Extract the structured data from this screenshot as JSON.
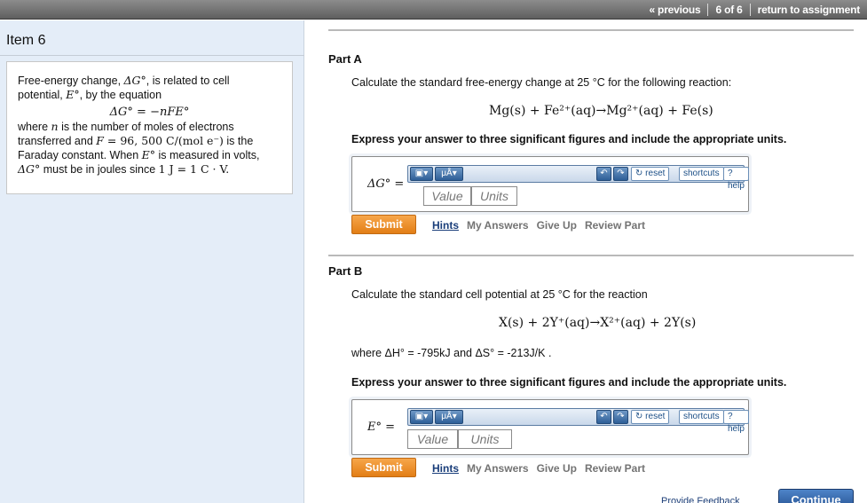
{
  "nav": {
    "previous": "« previous",
    "position": "6 of 6",
    "return": "return to assignment"
  },
  "sidebar": {
    "item_title": "Item 6",
    "info": {
      "l1a": "Free-energy change, ",
      "l1b": "ΔG°",
      "l1c": ", is related to cell",
      "l2a": "potential, ",
      "l2b": "E°",
      "l2c": ", by the equation",
      "equation": "ΔG° = −nFE°",
      "l4a": "where ",
      "l4b": "n",
      "l4c": " is the number of moles of electrons",
      "l5a": "transferred and ",
      "l5b": "F",
      "l5c": " = 96, 500 C/(mol e⁻)",
      "l5d": " is the",
      "l6": "Faraday constant. When ",
      "l6b": "E°",
      "l6c": " is measured in volts,",
      "l7a": "ΔG°",
      "l7b": " must be in joules since ",
      "l7c": "1 J = 1 C · V."
    }
  },
  "partA": {
    "title": "Part A",
    "question": "Calculate the standard free-energy change at 25 °C for the following reaction:",
    "reaction": "Mg(s) + Fe²⁺(aq)→Mg²⁺(aq) + Fe(s)",
    "instruction": "Express your answer to three significant figures and include the appropriate units.",
    "answer_label": "ΔG° =",
    "value_placeholder": "Value",
    "units_placeholder": "Units",
    "submit": "Submit"
  },
  "partB": {
    "title": "Part B",
    "question": "Calculate the standard cell potential at 25 °C for the reaction",
    "reaction": "X(s) + 2Y⁺(aq)→X²⁺(aq) + 2Y(s)",
    "where": "where ΔH° = -795kJ and ΔS° = -213J/K .",
    "instruction": "Express your answer to three significant figures and include the appropriate units.",
    "answer_label": "E° =",
    "value_placeholder": "Value",
    "units_placeholder": "Units",
    "submit": "Submit"
  },
  "toolbar": {
    "templates_icon": "template-icon",
    "units_label": "μÅ",
    "undo_icon": "undo-icon",
    "redo_icon": "redo-icon",
    "reset": "reset",
    "shortcuts": "shortcuts",
    "help": "? help"
  },
  "links": {
    "hints": "Hints",
    "my_answers": "My Answers",
    "give_up": "Give Up",
    "review_part": "Review Part"
  },
  "footer": {
    "feedback": "Provide Feedback",
    "continue": "Continue"
  }
}
